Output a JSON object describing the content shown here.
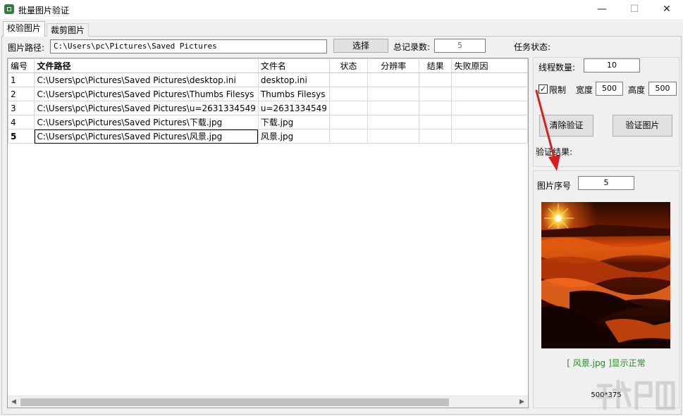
{
  "window": {
    "title": "批量图片验证",
    "minimize": "—",
    "maximize": "☐",
    "close": "✕"
  },
  "tabs": [
    {
      "label": "校验图片"
    },
    {
      "label": "裁剪图片"
    }
  ],
  "path_row": {
    "label": "图片路径:",
    "value": "C:\\Users\\pc\\Pictures\\Saved Pictures",
    "browse_label": "选择",
    "total_label": "总记录数:",
    "total_value": "5",
    "task_status_label": "任务状态:"
  },
  "grid": {
    "columns": [
      "编号",
      "文件路径",
      "文件名",
      "状态",
      "分辨率",
      "结果",
      "失败原因"
    ],
    "rows": [
      [
        "1",
        "C:\\Users\\pc\\Pictures\\Saved Pictures\\desktop.ini",
        "desktop.ini",
        "",
        "",
        "",
        ""
      ],
      [
        "2",
        "C:\\Users\\pc\\Pictures\\Saved Pictures\\Thumbs Filesys",
        "Thumbs Filesys",
        "",
        "",
        "",
        ""
      ],
      [
        "3",
        "C:\\Users\\pc\\Pictures\\Saved Pictures\\u=2631334549",
        "u=2631334549",
        "",
        "",
        "",
        ""
      ],
      [
        "4",
        "C:\\Users\\pc\\Pictures\\Saved Pictures\\下载.jpg",
        "下载.jpg",
        "",
        "",
        "",
        ""
      ],
      [
        "5",
        "C:\\Users\\pc\\Pictures\\Saved Pictures\\风景.jpg",
        "风景.jpg",
        "",
        "",
        "",
        ""
      ]
    ],
    "selected_row": 5
  },
  "settings": {
    "threads_label": "线程数量:",
    "threads_value": "10",
    "limit_label": "限制",
    "limit_checked": true,
    "width_label": "宽度",
    "width_value": "500",
    "height_label": "高度",
    "height_value": "500",
    "clear_button": "清除验证",
    "verify_button": "验证图片",
    "result_label": "验证结果:"
  },
  "preview": {
    "index_label": "图片序号",
    "index_value": "5",
    "status_text": "[ 风景.jpg ]显示正常",
    "status_color": "#1e8c1e",
    "size_text": "500*375"
  },
  "colors": {
    "annotation_arrow": "#d42020"
  }
}
